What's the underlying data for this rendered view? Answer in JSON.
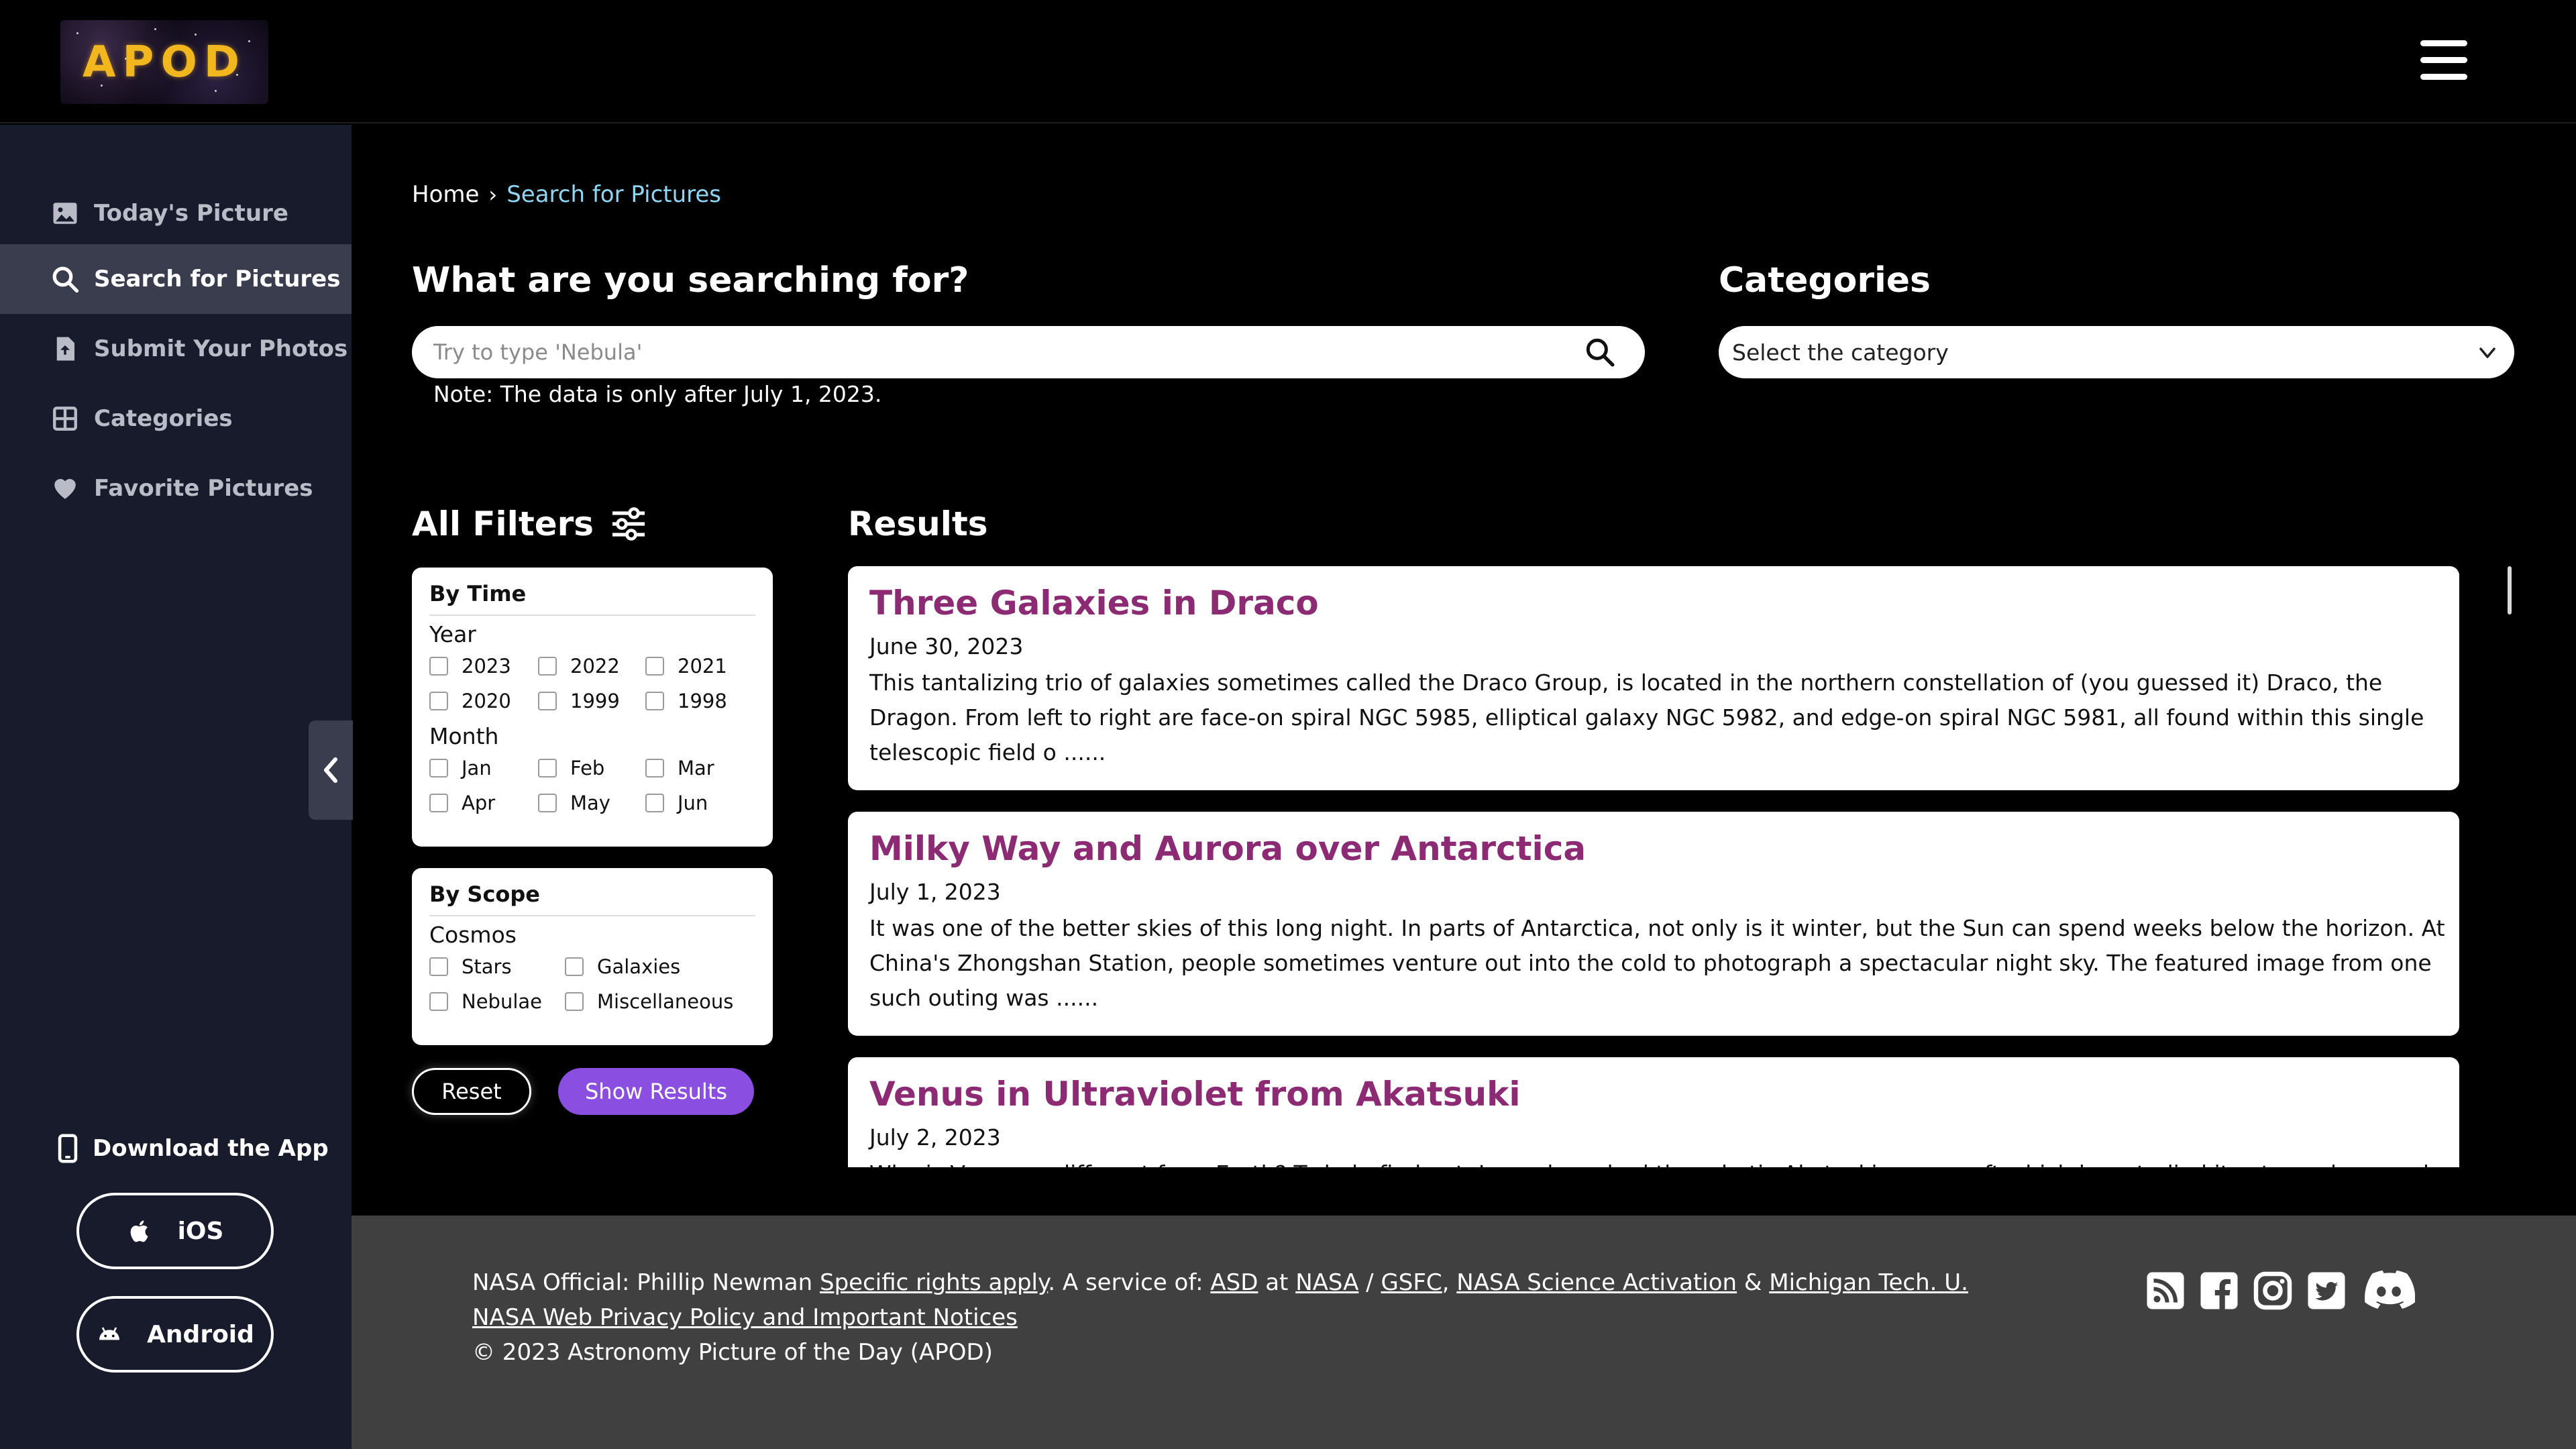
{
  "header": {
    "logo_text": "APOD"
  },
  "sidebar": {
    "items": [
      {
        "label": "Today's Picture",
        "icon": "image-icon"
      },
      {
        "label": "Search for Pictures",
        "icon": "search-icon"
      },
      {
        "label": "Submit Your Photos",
        "icon": "file-upload-icon"
      },
      {
        "label": "Categories",
        "icon": "grid-icon"
      },
      {
        "label": "Favorite Pictures",
        "icon": "heart-icon"
      }
    ],
    "active_index": 1,
    "download_title": "Download the App",
    "ios_label": "iOS",
    "android_label": "Android"
  },
  "breadcrumb": {
    "home": "Home",
    "current": "Search for Pictures"
  },
  "search": {
    "heading": "What are you searching for?",
    "placeholder": "Try to type 'Nebula'",
    "value": "",
    "note": "Note: The data is only after July 1, 2023."
  },
  "categories": {
    "heading": "Categories",
    "selected": "Select the category"
  },
  "filters": {
    "heading": "All Filters",
    "by_time": {
      "title": "By Time",
      "year_label": "Year",
      "years": [
        "2023",
        "2022",
        "2021",
        "2020",
        "1999",
        "1998"
      ],
      "month_label": "Month",
      "months": [
        "Jan",
        "Feb",
        "Mar",
        "Apr",
        "May",
        "Jun"
      ]
    },
    "by_scope": {
      "title": "By Scope",
      "cosmos_label": "Cosmos",
      "options": [
        "Stars",
        "Galaxies",
        "Nebulae",
        "Miscellaneous"
      ]
    },
    "reset_label": "Reset",
    "show_label": "Show Results"
  },
  "results": {
    "heading": "Results",
    "items": [
      {
        "title": "Three Galaxies in Draco",
        "date": "June 30, 2023",
        "excerpt": "This tantalizing trio of galaxies sometimes called the Draco Group, is located in the northern constellation of (you guessed it) Draco, the Dragon. From left to right are face-on spiral NGC 5985, elliptical galaxy NGC 5982, and edge-on spiral NGC 5981, all found within this single telescopic field o ......"
      },
      {
        "title": "Milky Way and Aurora over Antarctica",
        "date": "July 1, 2023",
        "excerpt": "It was one of the better skies of this long night. In parts of Antarctica, not only is it winter, but the Sun can spend weeks below the horizon. At China's Zhongshan Station, people sometimes venture out into the cold to photograph a spectacular night sky. The featured image from one such outing was ......"
      },
      {
        "title": "Venus in Ultraviolet from Akatsuki",
        "date": "July 2, 2023",
        "excerpt": "Why is Venus so different from Earth? To help find out, Japan launched the robotic Akatsuki spacecraft which has studied its atmosphere and clouds in ultraviolet light ......"
      }
    ]
  },
  "footer": {
    "official_prefix": "NASA Official: Phillip Newman ",
    "rights_link": "Specific rights apply",
    "service_text": ". A service of: ",
    "asd": "ASD",
    "at": " at ",
    "nasa": "NASA",
    "slash": " / ",
    "gsfc": "GSFC",
    "comma": ", ",
    "activation": "NASA Science Activation",
    "amp": " & ",
    "michigan": "Michigan Tech. U.",
    "privacy": "NASA Web Privacy Policy and Important Notices",
    "copyright": "© 2023 Astronomy Picture of the Day (APOD)"
  },
  "social_icons": [
    "rss-icon",
    "facebook-icon",
    "instagram-icon",
    "twitter-icon",
    "discord-icon"
  ],
  "colors": {
    "accent_title": "#8c2b73",
    "breadcrumb_current": "#8fd6f5",
    "show_results_button": "#8a4fe0",
    "sidebar_bg": "#171b2c",
    "footer_bg": "#404040"
  }
}
